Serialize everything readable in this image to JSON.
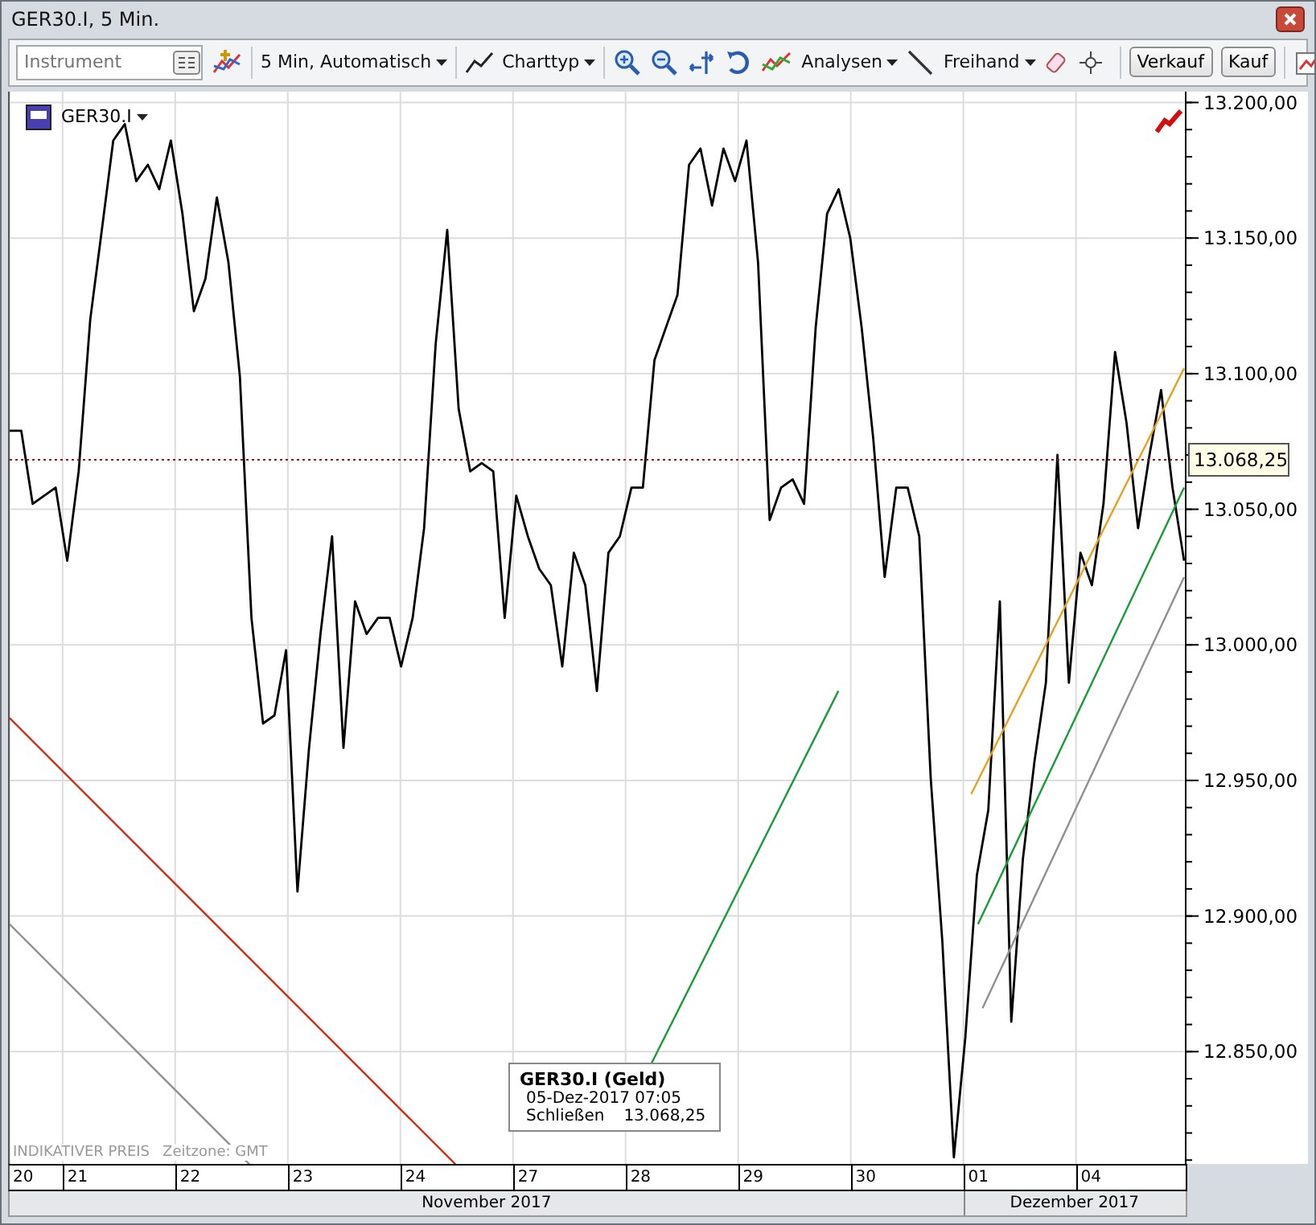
{
  "window": {
    "title": "GER30.I, 5 Min."
  },
  "toolbar": {
    "instrument": {
      "placeholder": "Instrument"
    },
    "interval": "5 Min,  Automatisch",
    "chart_type": "Charttyp",
    "analyses": "Analysen",
    "freehand": "Freihand",
    "sell": "Verkauf",
    "buy": "Kauf"
  },
  "chart": {
    "price_marker": {
      "label": "13.068,25"
    },
    "indicative": "INDIKATIVER PREIS",
    "timezone": "Zeitzone: GMT",
    "tooltip": {
      "title": "GER30.I (Geld)",
      "time": "05-Dez-2017 07:05",
      "label": "Schließen",
      "value": "13.068,25"
    },
    "months": [
      {
        "label": "November 2017",
        "days": [
          "20",
          "21",
          "22",
          "23",
          "24",
          "27",
          "28",
          "29",
          "30"
        ]
      },
      {
        "label": "Dezember 2017",
        "days": [
          "01",
          "04"
        ]
      }
    ],
    "chart_data": {
      "type": "line",
      "grid": true,
      "ylim": [
        12808,
        13204
      ],
      "categories": [
        null,
        null,
        null,
        null,
        null,
        null,
        null,
        null,
        null,
        null,
        null,
        null,
        null,
        null,
        null,
        null,
        null,
        null,
        null,
        null,
        null,
        null,
        null,
        null,
        null,
        null,
        null,
        null,
        null,
        null,
        null,
        null,
        null,
        null,
        null,
        null,
        null,
        null,
        null,
        null,
        null,
        null,
        null,
        null,
        null,
        null,
        null,
        null,
        null,
        null,
        null,
        null,
        null,
        null,
        null,
        null,
        null,
        null,
        null,
        null,
        null,
        null,
        null,
        null,
        null,
        null,
        null,
        null,
        null,
        null,
        null,
        null,
        null,
        null,
        null,
        null,
        null,
        null,
        null,
        null,
        null,
        null,
        null,
        null,
        null,
        null,
        null,
        null,
        null,
        null,
        null,
        null,
        null,
        null,
        null,
        null,
        null,
        null,
        null,
        null,
        null,
        null,
        null
      ],
      "series": [
        {
          "name": "GER30.I",
          "color": "#000000",
          "values": [
            13079,
            13079,
            13052,
            13055,
            13058,
            13031,
            13064,
            13120,
            13153,
            13186,
            13192,
            13171,
            13177,
            13168,
            13186,
            13159,
            13123,
            13135,
            13165,
            13141,
            13099,
            13010,
            12971,
            12974,
            12998,
            12909,
            12962,
            13004,
            13040,
            12962,
            13016,
            13004,
            13010,
            13010,
            12992,
            13010,
            13043,
            13111,
            13153,
            13087,
            13064,
            13067,
            13064,
            13010,
            13055,
            13040,
            13028,
            13022,
            12992,
            13034,
            13022,
            12983,
            13034,
            13040,
            13058,
            13058,
            13105,
            13117,
            13129,
            13177,
            13183,
            13162,
            13183,
            13171,
            13186,
            13141,
            13046,
            13058,
            13061,
            13052,
            13117,
            13159,
            13168,
            13150,
            13117,
            13076,
            13025,
            13058,
            13058,
            13040,
            12951,
            12891,
            12811,
            12855,
            12915,
            12939,
            13016,
            12861,
            12921,
            12957,
            12986,
            13070,
            12986,
            13034,
            13022,
            13052,
            13108,
            13082,
            13043,
            13070,
            13094,
            13058,
            13031
          ]
        }
      ],
      "yticks": [
        {
          "value": 12850,
          "label": "12.850,00"
        },
        {
          "value": 12900,
          "label": "12.900,00"
        },
        {
          "value": 12950,
          "label": "12.950,00"
        },
        {
          "value": 13000,
          "label": "13.000,00"
        },
        {
          "value": 13050,
          "label": "13.050,00"
        },
        {
          "value": 13100,
          "label": "13.100,00"
        },
        {
          "value": 13150,
          "label": "13.150,00"
        },
        {
          "value": 13200,
          "label": "13.200,00"
        }
      ]
    }
  }
}
